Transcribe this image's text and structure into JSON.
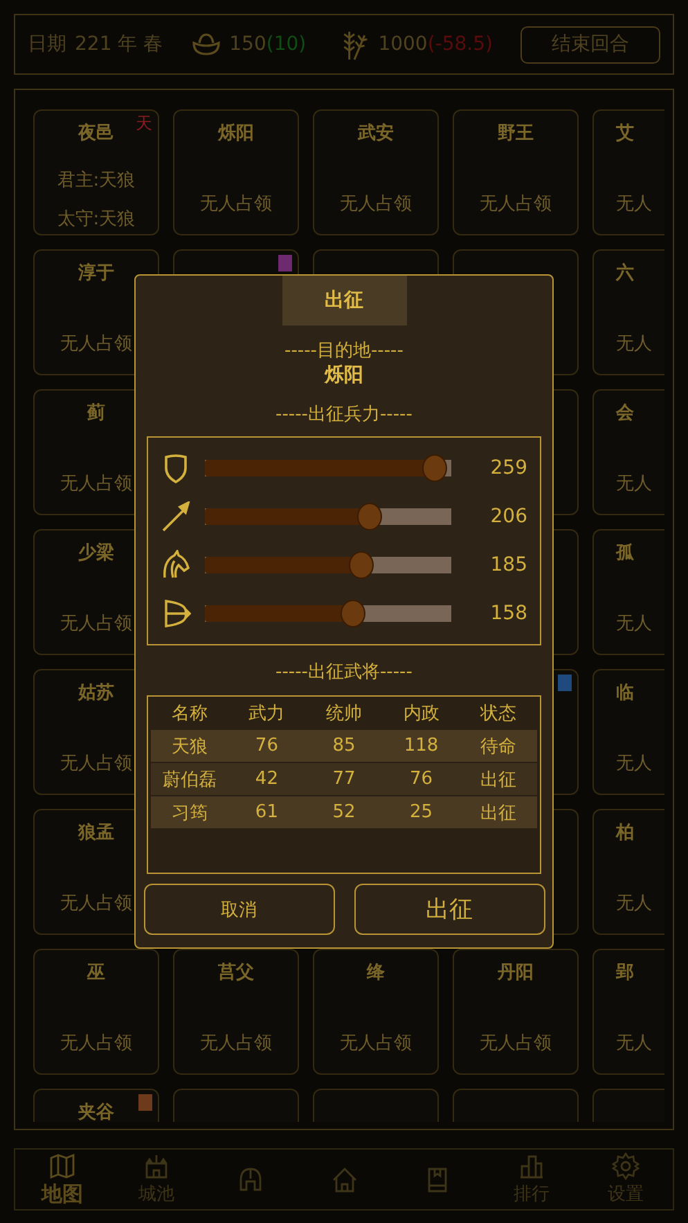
{
  "top_bar": {
    "date_label": "日期",
    "date_value": "221 年 春",
    "gold": "150",
    "gold_change": "(10)",
    "grain": "1000",
    "grain_change": "(-58.5)",
    "end_turn_button": "结束回合"
  },
  "grid": {
    "rows": [
      [
        {
          "kind": "city",
          "name": "夜邑",
          "lines": [
            "君主:天狼",
            "太守:天狼"
          ],
          "badge": {
            "text": "天",
            "color": "#8a1c22"
          }
        },
        {
          "kind": "city",
          "name": "烁阳",
          "lines": [
            "无人占领"
          ]
        },
        {
          "kind": "city",
          "name": "武安",
          "lines": [
            "无人占领"
          ]
        },
        {
          "kind": "city",
          "name": "野王",
          "lines": [
            "无人占领"
          ]
        },
        {
          "kind": "edge",
          "name": "艾",
          "lines": [
            "无人"
          ]
        }
      ],
      [
        {
          "kind": "city",
          "name": "淳于",
          "lines": [
            "无人占领"
          ]
        },
        {
          "kind": "covered",
          "badge": {
            "color": "#6e2a6e"
          }
        },
        {
          "kind": "covered"
        },
        {
          "kind": "covered"
        },
        {
          "kind": "edge",
          "name": "六",
          "lines": [
            "无人"
          ]
        }
      ],
      [
        {
          "kind": "city",
          "name": "蓟",
          "lines": [
            "无人占领"
          ]
        },
        {
          "kind": "hidden"
        },
        {
          "kind": "hidden"
        },
        {
          "kind": "covered"
        },
        {
          "kind": "edge",
          "name": "会",
          "lines": [
            "无人"
          ]
        }
      ],
      [
        {
          "kind": "city",
          "name": "少梁",
          "lines": [
            "无人占领"
          ]
        },
        {
          "kind": "hidden"
        },
        {
          "kind": "hidden"
        },
        {
          "kind": "covered"
        },
        {
          "kind": "edge",
          "name": "孤",
          "lines": [
            "无人"
          ]
        }
      ],
      [
        {
          "kind": "city",
          "name": "姑苏",
          "lines": [
            "无人占领"
          ]
        },
        {
          "kind": "covered"
        },
        {
          "kind": "covered"
        },
        {
          "kind": "covered",
          "badge": {
            "color": "#1f4a7e"
          }
        },
        {
          "kind": "edge",
          "name": "临",
          "lines": [
            "无人"
          ]
        }
      ],
      [
        {
          "kind": "city",
          "name": "狼孟",
          "lines": [
            "无人占领"
          ]
        },
        {
          "kind": "covered"
        },
        {
          "kind": "covered"
        },
        {
          "kind": "covered"
        },
        {
          "kind": "edge",
          "name": "柏",
          "lines": [
            "无人"
          ]
        }
      ],
      [
        {
          "kind": "city",
          "name": "巫",
          "lines": [
            "无人占领"
          ]
        },
        {
          "kind": "city",
          "name": "莒父",
          "lines": [
            "无人占领"
          ]
        },
        {
          "kind": "city",
          "name": "绛",
          "lines": [
            "无人占领"
          ]
        },
        {
          "kind": "city",
          "name": "丹阳",
          "lines": [
            "无人占领"
          ]
        },
        {
          "kind": "edge",
          "name": "郢",
          "lines": [
            "无人"
          ]
        }
      ],
      [
        {
          "kind": "city",
          "name": "夹谷",
          "badge": {
            "color": "#6e3a1c"
          }
        },
        {
          "kind": "city"
        },
        {
          "kind": "city"
        },
        {
          "kind": "city"
        },
        {
          "kind": "edge"
        }
      ]
    ]
  },
  "dialog": {
    "title": "出征",
    "destination_heading": "-----目的地-----",
    "destination": "烁阳",
    "troops_heading": "-----出征兵力-----",
    "troops": [
      {
        "kind": "shield",
        "level": 0.98,
        "reading": "259"
      },
      {
        "kind": "spear",
        "level": 0.69,
        "reading": "206"
      },
      {
        "kind": "horse",
        "level": 0.65,
        "reading": "185"
      },
      {
        "kind": "bow",
        "level": 0.61,
        "reading": "158"
      }
    ],
    "generals_heading": "-----出征武将-----",
    "table": {
      "columns": [
        "名称",
        "武力",
        "统帅",
        "内政",
        "状态"
      ],
      "rows": [
        [
          "天狼",
          "76",
          "85",
          "118",
          "待命"
        ],
        [
          "蔚伯磊",
          "42",
          "77",
          "76",
          "出征"
        ],
        [
          "习筠",
          "61",
          "52",
          "25",
          "出征"
        ]
      ]
    },
    "cancel_button": "取消",
    "confirm_button": "出征"
  },
  "nav": [
    {
      "label": "地图",
      "selected": true
    },
    {
      "label": "城池",
      "selected": false
    },
    {
      "selected": false
    },
    {
      "selected": false
    },
    {
      "selected": false
    },
    {
      "label": "排行",
      "selected": false
    },
    {
      "label": "设置",
      "selected": false
    }
  ]
}
